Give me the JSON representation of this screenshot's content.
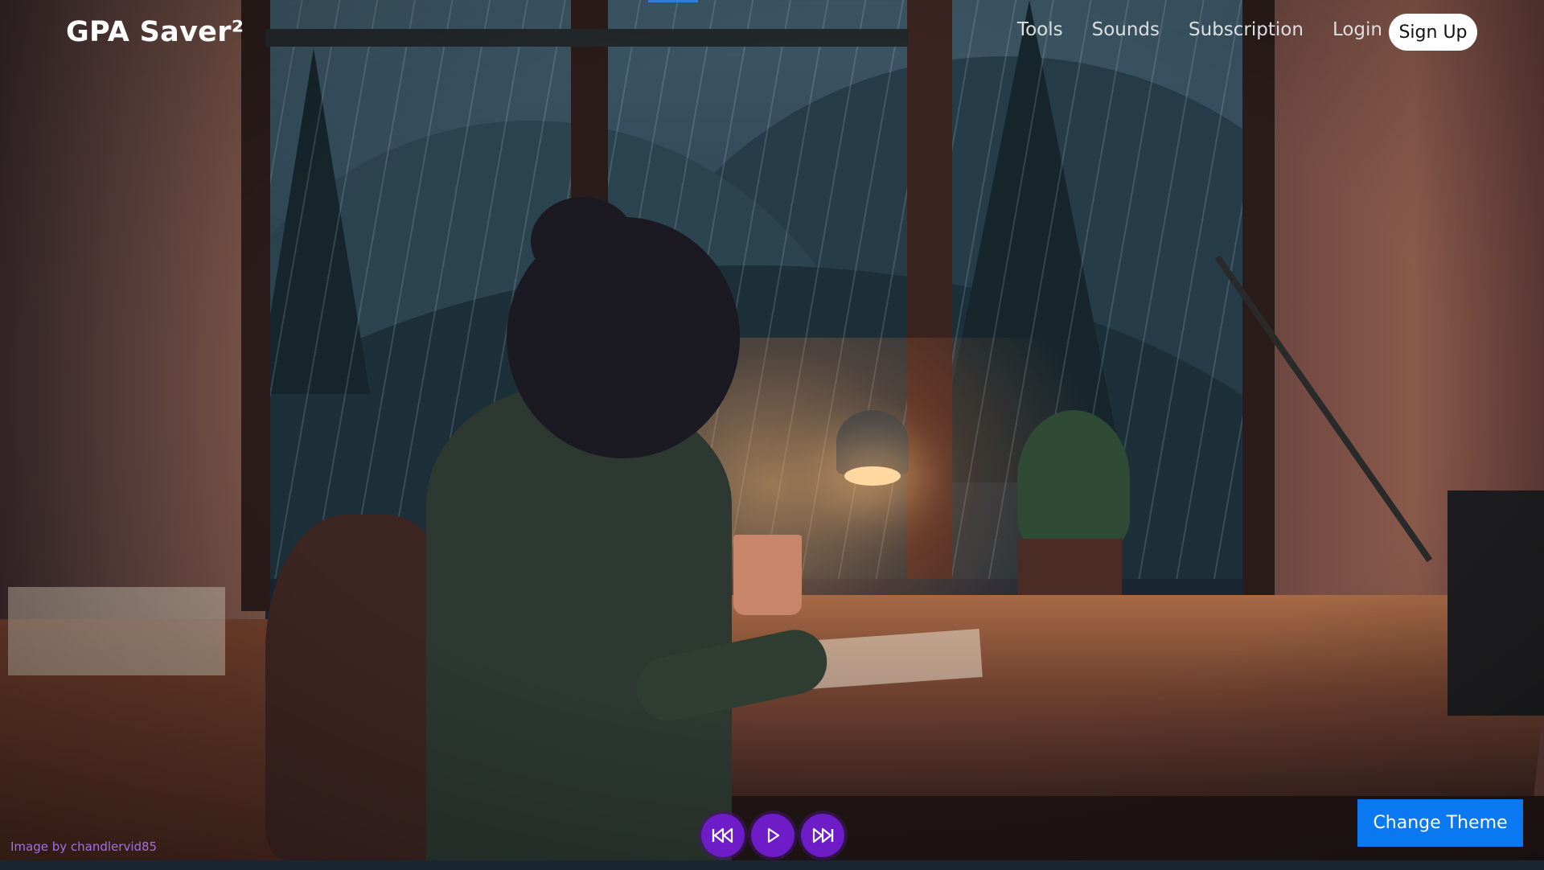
{
  "header": {
    "brand": "GPA Saver²",
    "nav": [
      "Tools",
      "Sounds",
      "Subscription",
      "Login"
    ],
    "signup_label": "Sign Up"
  },
  "player": {
    "buttons": [
      {
        "icon": "skip-back-icon"
      },
      {
        "icon": "play-icon"
      },
      {
        "icon": "skip-forward-icon"
      }
    ]
  },
  "footer": {
    "credit": "Image by chandlervid85",
    "change_theme_label": "Change Theme"
  },
  "colors": {
    "player_button": "#6d1cc8",
    "change_theme_button": "#0a78f0",
    "credit_text": "#a46fe0",
    "signup_background": "#ffffff"
  }
}
